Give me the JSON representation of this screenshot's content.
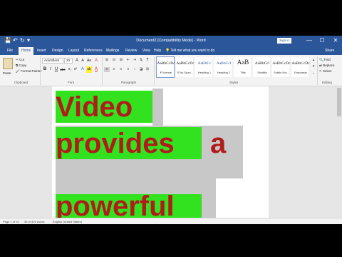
{
  "window": {
    "title": "Document2 [Compatibility Mode] - Word",
    "signin_label": "Sign in",
    "minimize": "—",
    "maximize": "☐",
    "close": "✕"
  },
  "quick_access": {
    "save": "💾",
    "undo": "↶",
    "redo": "↻",
    "customize": "▾"
  },
  "tabs": [
    "File",
    "Home",
    "Insert",
    "Design",
    "Layout",
    "References",
    "Mailings",
    "Review",
    "View",
    "Help"
  ],
  "active_tab": "Home",
  "tell_me": "Tell me what you want to do",
  "share_label": "Share",
  "ribbon": {
    "clipboard": {
      "paste": "Paste",
      "cut": "Cut",
      "copy": "Copy",
      "format_painter": "Format Painter",
      "label": "Clipboard"
    },
    "font": {
      "name": "Arial Black",
      "size": "20",
      "label": "Font",
      "bold": "B",
      "italic": "I",
      "underline": "U",
      "strike": "abc",
      "sub": "x₂",
      "sup": "x²",
      "grow": "A",
      "shrink": "A",
      "case": "Aa",
      "clear": "A",
      "effects": "A",
      "highlight": "ab",
      "color": "A"
    },
    "paragraph": {
      "label": "Paragraph"
    },
    "styles": {
      "label": "Styles",
      "items": [
        {
          "sample": "AaBbCcDc",
          "name": "¶ Normal"
        },
        {
          "sample": "AaBbCcDc",
          "name": "¶ No Spac..."
        },
        {
          "sample": "AaBbCc",
          "name": "Heading 1"
        },
        {
          "sample": "AaBbCcl",
          "name": "Heading 2"
        },
        {
          "sample": "AaB",
          "name": "Title"
        },
        {
          "sample": "AaBbCcl",
          "name": "Subtitle"
        },
        {
          "sample": "AaBbCcDc",
          "name": "Subtle Em..."
        },
        {
          "sample": "AaBbCcDc",
          "name": "Emphasis"
        }
      ]
    },
    "editing": {
      "find": "Find",
      "replace": "Replace",
      "select": "Select",
      "label": "Editing"
    }
  },
  "document": {
    "lines": [
      [
        "Video"
      ],
      [
        "provides",
        "a"
      ],
      [
        "powerful"
      ]
    ]
  },
  "status": {
    "page": "Page 1 of 10",
    "words": "36 of 401 words",
    "language": "English (United States)"
  },
  "colors": {
    "accent": "#2b579a",
    "text_red": "#b01c1c",
    "highlight_green": "#33e21f",
    "shading_gray": "#c8c8c8"
  }
}
